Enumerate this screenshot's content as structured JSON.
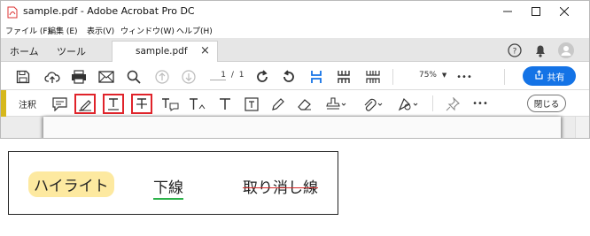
{
  "window": {
    "title": "sample.pdf - Adobe Acrobat Pro DC",
    "controls": [
      "minimize",
      "maximize",
      "close"
    ]
  },
  "menu": {
    "items": [
      "ファイル (F)",
      "編集 (E)",
      "表示(V)",
      "ウィンドウ(W)",
      "ヘルプ(H)"
    ]
  },
  "tabs": {
    "home": "ホーム",
    "tools": "ツール",
    "document": "sample.pdf",
    "close_glyph": "×"
  },
  "toolbar": {
    "page_current": "1",
    "page_sep": "/",
    "page_total": "1",
    "zoom": "75%",
    "more": "•••",
    "share_label": "共有"
  },
  "comment_toolbar": {
    "label": "注釈",
    "more": "•••",
    "close_label": "閉じる",
    "highlighted_tools": [
      "highlight-tool",
      "underline-tool",
      "strikethrough-tool"
    ]
  },
  "example": {
    "highlight_text": "ハイライト",
    "underline_text": "下線",
    "strike_text": "取り消し線"
  },
  "colors": {
    "accent_blue": "#1473e6",
    "comment_accent": "#d6b81c",
    "selection_red": "#e0232a",
    "highlight_yellow": "#fde9a0",
    "underline_green": "#2db24b",
    "strike_red": "#d52a2a"
  }
}
